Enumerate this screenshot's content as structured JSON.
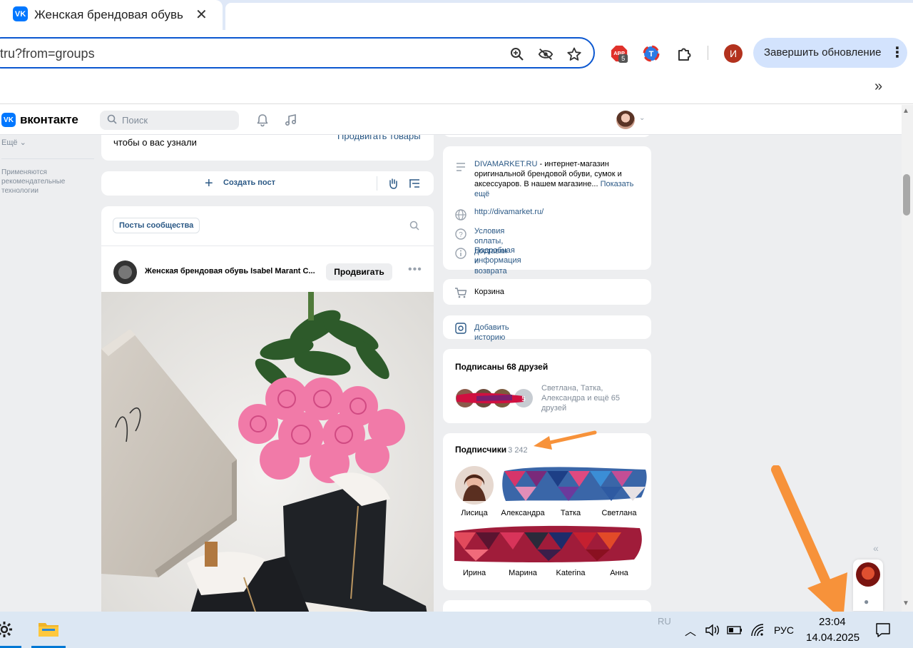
{
  "browser": {
    "tab_title": "Женская брендовая обувь Isabel Marant Chanel",
    "url": "tru?from=groups",
    "update_button": "Завершить обновление",
    "profile_initial": "И",
    "ext_badge_count": "5"
  },
  "vk": {
    "brand": "вконтакте",
    "search_placeholder": "Поиск",
    "left_nav": {
      "more": "Ещё",
      "note": "Применяются рекомендательные технологии"
    },
    "top_card": {
      "text": "чтобы о вас узнали",
      "link": "Продвигать товары"
    },
    "create_post": "Создать пост",
    "posts": {
      "chip": "Посты сообщества",
      "author": "Женская брендовая обувь Isabel Marant C...",
      "promote_button": "Продвигать"
    },
    "info": {
      "desc_link": "DIVAMARKET.RU",
      "desc_text": " - интернет-магазин оригинальной брендовой обуви, сумок и аксессуаров. В нашем магазине...",
      "show_more": "Показать ещё",
      "website": "http://divamarket.ru/",
      "terms": "Условия оплаты, доставки и возврата",
      "details": "Подробная информация"
    },
    "cart": "Корзина",
    "add_story": "Добавить историю",
    "friends": {
      "title": "Подписаны 68 друзей",
      "names": "Светлана, Татка, Александра и ещё 65 друзей"
    },
    "subscribers": {
      "title": "Подписчики",
      "count": "3 242",
      "names": [
        "Лисица",
        "Александра",
        "Татка",
        "Светлана",
        "Ирина",
        "Марина",
        "Katerina",
        "Анна"
      ]
    }
  },
  "taskbar": {
    "lang_small": "RU",
    "lang": "РУС",
    "time": "23:04",
    "date": "14.04.2025"
  },
  "colors": {
    "vk_blue": "#0077ff",
    "vk_link": "#2a5885",
    "annotation_arrow": "#f7923a"
  }
}
